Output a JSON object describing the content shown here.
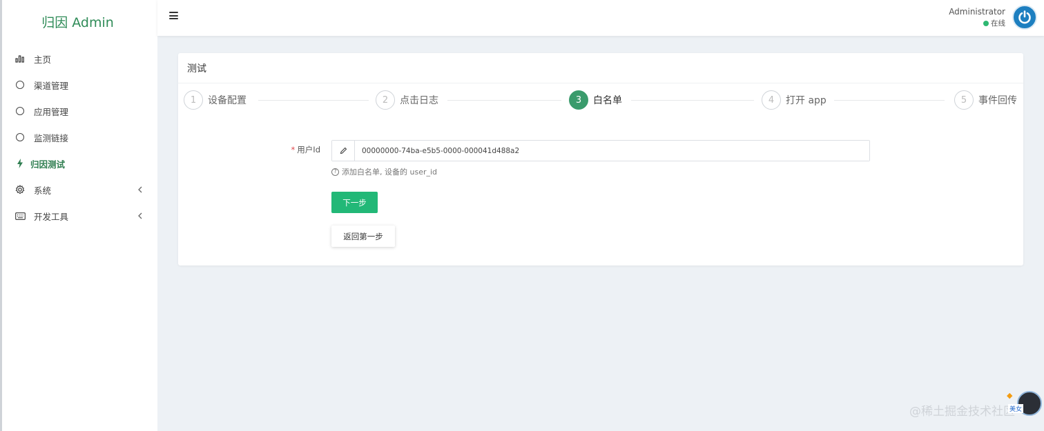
{
  "brand": {
    "title": "归因 Admin"
  },
  "sidebar": {
    "items": [
      {
        "label": "主页",
        "icon": "bar-chart-icon"
      },
      {
        "label": "渠道管理",
        "icon": "circle-icon"
      },
      {
        "label": "应用管理",
        "icon": "circle-icon"
      },
      {
        "label": "监测链接",
        "icon": "circle-icon"
      },
      {
        "label": "归因测试",
        "icon": "bolt-icon",
        "active": true
      },
      {
        "label": "系统",
        "icon": "gear-icon",
        "expandable": true
      },
      {
        "label": "开发工具",
        "icon": "keyboard-icon",
        "expandable": true
      }
    ]
  },
  "header": {
    "user_name": "Administrator",
    "user_status": "在线"
  },
  "card": {
    "title": "测试",
    "steps": [
      {
        "num": "1",
        "title": "设备配置"
      },
      {
        "num": "2",
        "title": "点击日志"
      },
      {
        "num": "3",
        "title": "白名单",
        "current": true
      },
      {
        "num": "4",
        "title": "打开 app"
      },
      {
        "num": "5",
        "title": "事件回传"
      }
    ],
    "form": {
      "required_mark": "*",
      "user_id_label": "用户Id",
      "user_id_value": "00000000-74ba-e5b5-0000-000041d488a2",
      "help_icon": "?",
      "help_text": "添加白名单, 设备的 user_id"
    },
    "buttons": {
      "next": "下一步",
      "back": "返回第一步"
    }
  },
  "watermark": {
    "text": "@稀土掘金技术社区",
    "tag": "美女"
  },
  "colors": {
    "brand_green": "#2e8b57",
    "primary_button": "#22b877",
    "current_step": "#3a9b6c",
    "avatar_blue": "#1d7fc0",
    "online_dot": "#2eb872"
  }
}
